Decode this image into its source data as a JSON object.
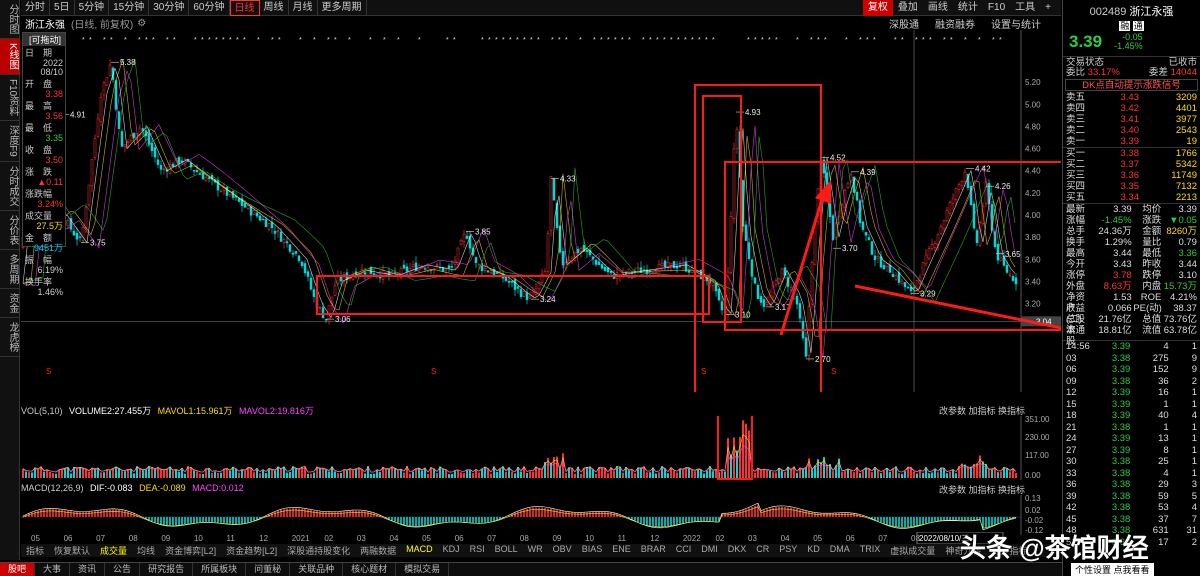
{
  "leftnav": [
    "分时图",
    "K线图",
    "F10资料",
    "深度F9",
    "分时成交",
    "分价表",
    "多周期",
    "资金",
    "龙虎榜"
  ],
  "periods": [
    "分时",
    "5日",
    "5分钟",
    "15分钟",
    "30分钟",
    "60分钟",
    "日线",
    "周线",
    "月线",
    "更多周期"
  ],
  "rtools": [
    "复权",
    "叠加",
    "画线",
    "统计",
    "F10",
    "工具",
    "+"
  ],
  "stock": {
    "name": "浙江永强",
    "period_note": "(日线, 前复权)",
    "code": "002489",
    "price": "3.39",
    "change": "-0.05",
    "pct": "-1.45%",
    "tag1": "融",
    "tag2": "通"
  },
  "subbar_right": [
    "深股通",
    "融资融券",
    "设置与统计"
  ],
  "infobox": {
    "title": "[可拖动]",
    "date_l": "日　期",
    "date": "2022\n08/10",
    "open_l": "开　盘",
    "open": "3.38",
    "high_l": "最　高",
    "high": "3.56",
    "low_l": "最　低",
    "low": "3.35",
    "close_l": "收　盘",
    "close": "3.50",
    "chg_l": "涨　跌",
    "chg": "▲0.11",
    "chgpct_l": "涨跌幅",
    "chgpct": "3.24%",
    "vol_l": "成交量",
    "vol": "27.5万",
    "amt_l": "金　额",
    "amt": "9451万",
    "amp_l": "振　幅",
    "amp": "6.19%",
    "turn_l": "换手率",
    "turn": "1.46%"
  },
  "price_labels": {
    "p538": "5.38",
    "p491": "4.91",
    "p375": "3.75",
    "p306": "3.06",
    "p385": "3.85",
    "p433": "4.33",
    "p324": "3.24",
    "p493": "4.93",
    "p310": "3.10",
    "p317": "3.17",
    "p270": "2.70",
    "p452": "4.52",
    "p439": "4.39",
    "p370": "3.70",
    "p329": "3.29",
    "p442": "4.42",
    "p426": "4.26",
    "p365": "3.65",
    "p304": "3.04"
  },
  "yaxis": [
    "5.20",
    "5.00",
    "4.80",
    "4.60",
    "4.40",
    "4.20",
    "4.00",
    "3.80",
    "3.60",
    "3.40",
    "3.20"
  ],
  "vol": {
    "label": "VOL(5,10)",
    "v1": "VOLUME2:27.455万",
    "v2": "MAVOL1:15.961万",
    "v3": "MAVOL2:19.816万",
    "y": [
      "351.00",
      "230.00",
      "117.00",
      "0.00"
    ],
    "ops": "改参数  加指标  换指标"
  },
  "macd": {
    "label": "MACD(12,26,9)",
    "dif": "DIF:-0.083",
    "dea": "DEA:-0.089",
    "m": "MACD:0.012",
    "y": [
      "0.13",
      "0.02",
      "-0.02",
      "-0.12"
    ]
  },
  "xaxis": [
    "05",
    "06",
    "07",
    "08",
    "09",
    "10",
    "11",
    "12",
    "2021",
    "02",
    "03",
    "04",
    "05",
    "06",
    "07",
    "08",
    "09",
    "10",
    "11",
    "12",
    "2022",
    "02",
    "03",
    "04",
    "05",
    "06",
    "07",
    "08",
    "2022/08/10/三"
  ],
  "indtabs": [
    "指标",
    "恢复默认",
    "成交量",
    "均线",
    "资金博弈[L2]",
    "资金趋势[L2]",
    "深股通持股变化",
    "两融数据",
    "MACD",
    "KDJ",
    "RSI",
    "BOLL",
    "WR",
    "OBV",
    "BIAS",
    "ENE",
    "BRAR",
    "CCI",
    "DMI",
    "DKX",
    "CR",
    "PSY",
    "KD",
    "DMA",
    "TRIX",
    "虚拟成交量",
    "神奇九转",
    "更多指标"
  ],
  "btabs": [
    "股吧",
    "大事",
    "资讯",
    "公告",
    "研究报告",
    "所属板块",
    "问董秘",
    "关联品种",
    "核心题材",
    "模拟交易"
  ],
  "rp": {
    "status_l": "交易状态",
    "status": "已收市",
    "wb_l": "委比",
    "wb": "33.17%",
    "wc_l": "委差",
    "wc": "14044",
    "signal": "DK点自动提示涨跌信号",
    "asks": [
      [
        "卖五",
        "3.43",
        "3209"
      ],
      [
        "卖四",
        "3.42",
        "4401"
      ],
      [
        "卖三",
        "3.41",
        "3977"
      ],
      [
        "卖二",
        "3.40",
        "2543"
      ],
      [
        "卖一",
        "3.39",
        "19"
      ]
    ],
    "bids": [
      [
        "买一",
        "3.38",
        "1766"
      ],
      [
        "买二",
        "3.37",
        "5342"
      ],
      [
        "买三",
        "3.36",
        "11749"
      ],
      [
        "买四",
        "3.35",
        "7132"
      ],
      [
        "买五",
        "3.34",
        "2213"
      ]
    ],
    "stats": [
      [
        "最新",
        "3.39",
        "均价",
        "3.39"
      ],
      [
        "涨幅",
        "-1.45%",
        "涨跌",
        "▼0.05"
      ],
      [
        "总手",
        "24.36万",
        "金额",
        "8260万"
      ],
      [
        "换手",
        "1.29%",
        "量比",
        "0.79"
      ],
      [
        "最高",
        "3.44",
        "最低",
        "3.36"
      ],
      [
        "今开",
        "3.43",
        "昨收",
        "3.44"
      ],
      [
        "涨停",
        "3.78",
        "跌停",
        "3.10"
      ],
      [
        "外盘",
        "8.63万",
        "内盘",
        "15.73万"
      ],
      [
        "净资产",
        "1.53",
        "ROE",
        "4.21%"
      ],
      [
        "收益(二)",
        "0.066",
        "PE(动)",
        "38.37"
      ],
      [
        "总股本",
        "21.76亿",
        "总值",
        "73.76亿"
      ],
      [
        "流通股",
        "18.81亿",
        "流值",
        "63.78亿"
      ]
    ],
    "ticks": [
      [
        "14:56",
        "3.39",
        "4",
        "1"
      ],
      [
        "03",
        "3.38",
        "275",
        "9"
      ],
      [
        "06",
        "3.39",
        "152",
        "9"
      ],
      [
        "09",
        "3.38",
        "36",
        "2"
      ],
      [
        "12",
        "3.39",
        "16",
        "1"
      ],
      [
        "15",
        "3.39",
        "1",
        "1"
      ],
      [
        "18",
        "3.39",
        "40",
        "4"
      ],
      [
        "21",
        "3.38",
        "1",
        "1"
      ],
      [
        "24",
        "3.39",
        "13",
        "1"
      ],
      [
        "27",
        "3.39",
        "8",
        "1"
      ],
      [
        "30",
        "3.38",
        "25",
        "1"
      ],
      [
        "33",
        "3.38",
        "4",
        "1"
      ],
      [
        "36",
        "3.38",
        "29",
        "3"
      ],
      [
        "39",
        "3.38",
        "59",
        "5"
      ],
      [
        "42",
        "3.38",
        "53",
        "4"
      ],
      [
        "45",
        "3.38",
        "37",
        "7"
      ],
      [
        "48",
        "3.38",
        "631",
        "31"
      ],
      [
        "51",
        "3.38",
        "17",
        "2"
      ]
    ],
    "bottom": "个性设置  点我看看"
  },
  "watermark": "头条 @茶馆财经"
}
